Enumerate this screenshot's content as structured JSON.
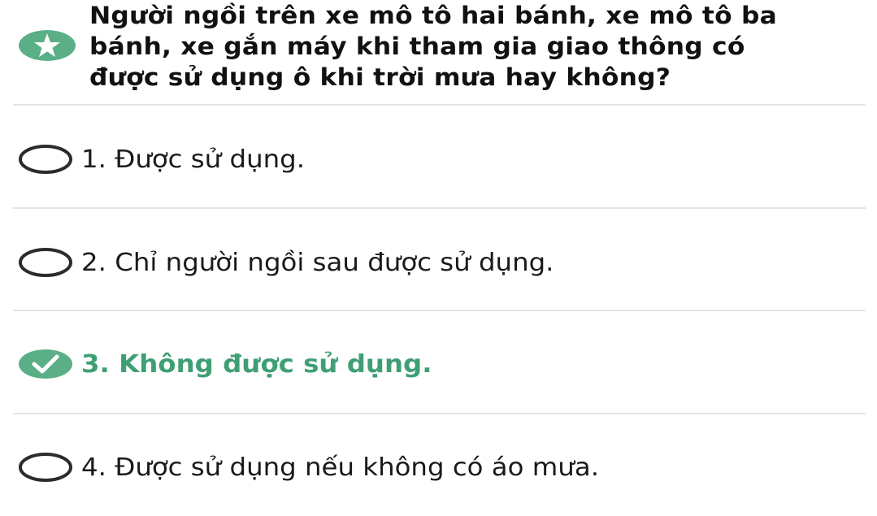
{
  "question": {
    "icon": "star-icon",
    "text_lines": [
      "Người ngồi trên xe mô tô hai bánh, xe mô tô ba",
      "bánh, xe gắn máy khi tham gia giao thông có",
      "được sử dụng ô khi trời mưa hay không?"
    ]
  },
  "options": [
    {
      "label": "1. Được sử dụng.",
      "selected": false
    },
    {
      "label": "2. Chỉ người ngồi sau được sử dụng.",
      "selected": false
    },
    {
      "label": "3. Không được sử dụng.",
      "selected": true
    },
    {
      "label": "4. Được sử dụng nếu không có áo mưa.",
      "selected": false
    }
  ],
  "colors": {
    "accent": "#5aaf86",
    "correct_text": "#3f9f74",
    "divider": "#e4e4e4",
    "radio_border": "#2b2b2b"
  }
}
